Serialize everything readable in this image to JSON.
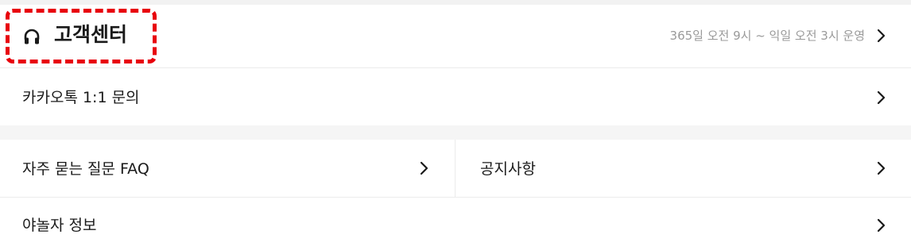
{
  "header": {
    "title": "고객센터",
    "hours_text": "365일 오전 9시 ~ 익일 오전 3시 운영"
  },
  "menu": {
    "kakaotalk_inquiry": "카카오톡 1:1 문의",
    "faq": "자주 묻는 질문 FAQ",
    "notice": "공지사항",
    "company_info": "야놀자 정보"
  },
  "colors": {
    "highlight": "#e8000b",
    "secondary_text": "#9a9a9a"
  },
  "icons": {
    "title_icon": "headset-icon",
    "arrow": "chevron-right-icon"
  }
}
